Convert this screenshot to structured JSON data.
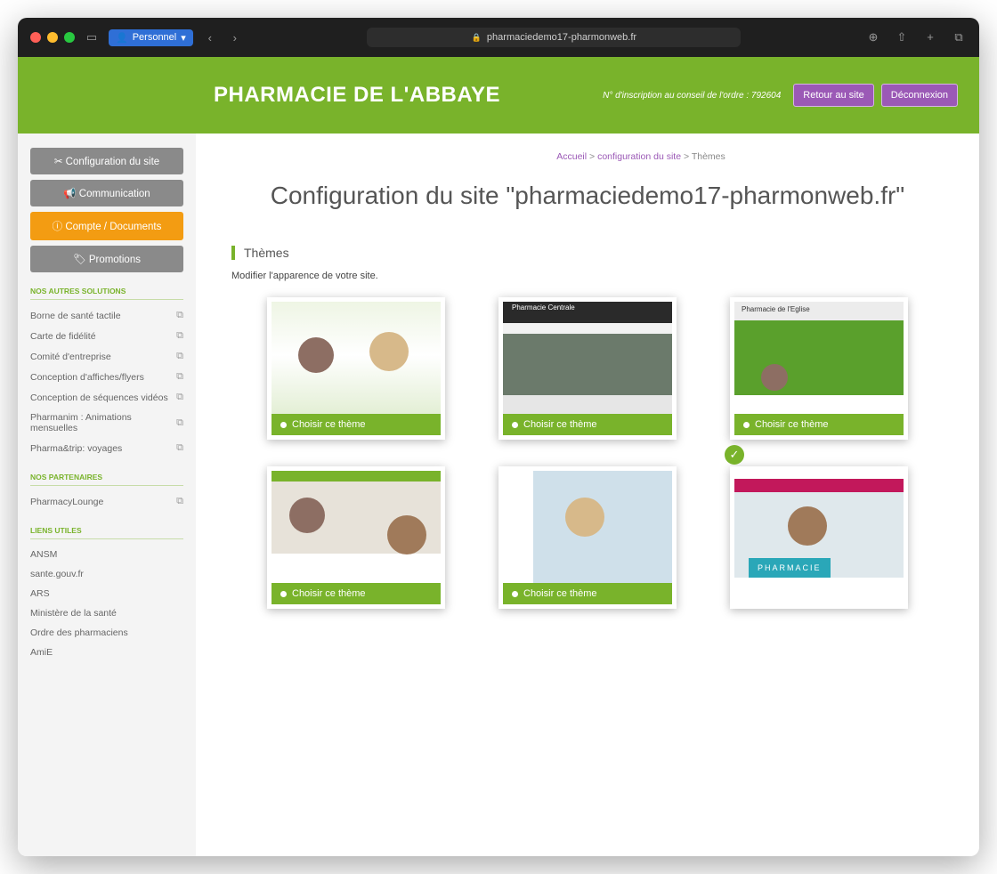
{
  "browser": {
    "profile": "Personnel",
    "url": "pharmaciedemo17-pharmonweb.fr"
  },
  "header": {
    "brand": "PHARMACIE DE L'ABBAYE",
    "ordre": "N° d'inscription au conseil de l'ordre : 792604",
    "retour": "Retour au site",
    "logout": "Déconnexion"
  },
  "sidebar": {
    "buttons": [
      "Configuration du site",
      "Communication",
      "Compte / Documents",
      "Promotions"
    ],
    "solutions_heading": "NOS AUTRES SOLUTIONS",
    "solutions": [
      "Borne de santé tactile",
      "Carte de fidélité",
      "Comité d'entreprise",
      "Conception d'affiches/flyers",
      "Conception de séquences vidéos",
      "Pharmanim : Animations mensuelles",
      "Pharma&trip: voyages"
    ],
    "partners_heading": "NOS PARTENAIRES",
    "partners": [
      "PharmacyLounge"
    ],
    "links_heading": "LIENS UTILES",
    "links": [
      "ANSM",
      "sante.gouv.fr",
      "ARS",
      "Ministère de la santé",
      "Ordre des pharmaciens",
      "AmiE"
    ]
  },
  "main": {
    "breadcrumb": {
      "home": "Accueil",
      "sep1": " > ",
      "config": "configuration du site",
      "sep2": " > ",
      "current": "Thèmes"
    },
    "title": "Configuration du site \"pharmaciedemo17-pharmonweb.fr\"",
    "section_title": "Thèmes",
    "section_desc": "Modifier l'apparence de votre site.",
    "choose_label": "Choisir ce thème",
    "theme3_header": "Pharmacie de l'Eglise",
    "theme2_header": "Pharmacie Centrale",
    "theme6_label": "PHARMACIE"
  },
  "colors": {
    "brand_green": "#79b32b",
    "purple": "#9b59b6",
    "orange": "#f39c12"
  }
}
